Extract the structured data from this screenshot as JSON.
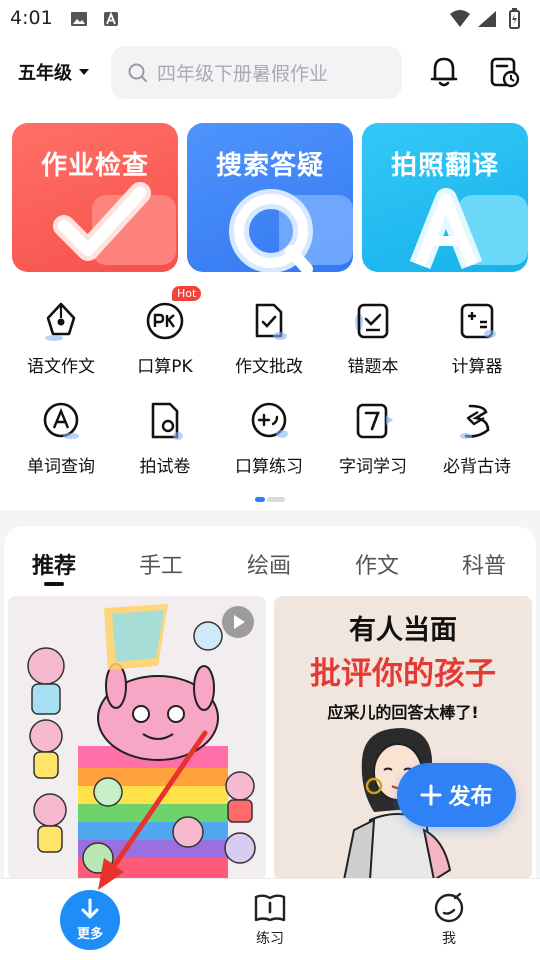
{
  "status_bar": {
    "time": "4:01"
  },
  "header": {
    "grade": "五年级",
    "search_placeholder": "四年级下册暑假作业"
  },
  "feature_cards": [
    {
      "label": "作业检查",
      "color": "#fb5b57"
    },
    {
      "label": "搜索答疑",
      "color": "#3f86f7"
    },
    {
      "label": "拍照翻译",
      "color": "#29bff2"
    }
  ],
  "tools": [
    {
      "label": "语文作文",
      "icon": "pen-nib-icon"
    },
    {
      "label": "口算PK",
      "icon": "pk-badge-icon",
      "badge": "Hot"
    },
    {
      "label": "作文批改",
      "icon": "document-check-icon"
    },
    {
      "label": "错题本",
      "icon": "notebook-check-icon"
    },
    {
      "label": "计算器",
      "icon": "calculator-icon"
    },
    {
      "label": "单词查询",
      "icon": "letter-a-icon"
    },
    {
      "label": "拍试卷",
      "icon": "camera-paper-icon"
    },
    {
      "label": "口算练习",
      "icon": "plus-bubble-icon"
    },
    {
      "label": "字词学习",
      "icon": "character-card-icon"
    },
    {
      "label": "必背古诗",
      "icon": "poem-scroll-icon"
    }
  ],
  "tabs": [
    "推荐",
    "手工",
    "绘画",
    "作文",
    "科普"
  ],
  "feed": {
    "right_post": {
      "line1": "有人当面",
      "line2": "批评你的孩子",
      "line3": "应采儿的回答太棒了!"
    }
  },
  "publish_button": "发布",
  "bottom_nav": {
    "more": "更多",
    "practice": "练习",
    "me": "我"
  },
  "accent_color": "#2f82f6"
}
